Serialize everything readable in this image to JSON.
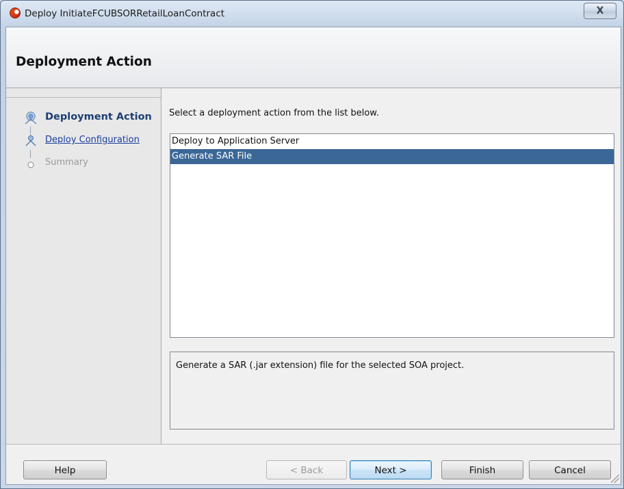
{
  "window": {
    "title": "Deploy InitiateFCUBSORRetailLoanContract",
    "close_label": "X"
  },
  "header": {
    "title": "Deployment Action"
  },
  "steps": [
    {
      "label": "Deployment Action",
      "state": "active"
    },
    {
      "label": "Deploy Configuration",
      "state": "link"
    },
    {
      "label": "Summary",
      "state": "disabled"
    }
  ],
  "main": {
    "instruction": "Select a deployment action from the list below.",
    "actions": [
      {
        "label": "Deploy to Application Server",
        "selected": false
      },
      {
        "label": "Generate SAR File",
        "selected": true
      }
    ],
    "description": "Generate a SAR (.jar extension) file for the selected SOA project."
  },
  "buttons": {
    "help": "Help",
    "back": "< Back",
    "next": "Next >",
    "finish": "Finish",
    "cancel": "Cancel"
  },
  "colors": {
    "selection": "#3b6797",
    "active_step": "#1d3f73",
    "link": "#1a3d9c"
  }
}
